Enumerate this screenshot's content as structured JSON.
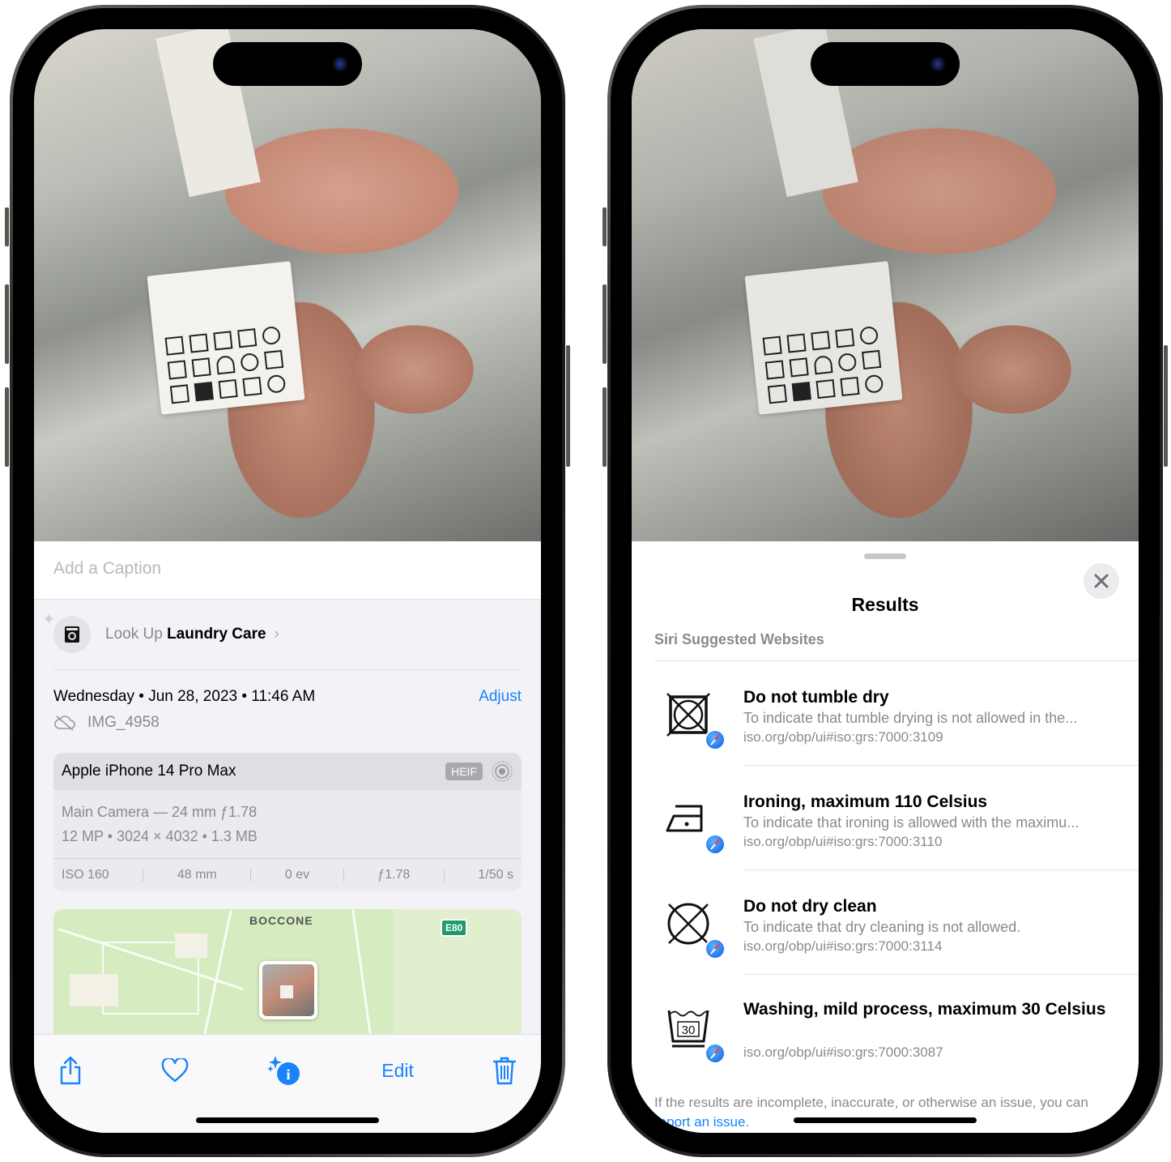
{
  "left_phone": {
    "caption_placeholder": "Add a Caption",
    "lookup": {
      "prefix": "Look Up",
      "subject": "Laundry Care",
      "chevron": "›",
      "icon": "washing-machine-icon"
    },
    "date_line": "Wednesday • Jun 28, 2023 • 11:46 AM",
    "adjust_label": "Adjust",
    "filename": "IMG_4958",
    "camera": {
      "device": "Apple iPhone 14 Pro Max",
      "format_badge": "HEIF",
      "lens": "Main Camera — 24 mm ƒ1.78",
      "specs": "12 MP  •  3024 × 4032  •  1.3 MB",
      "stats": [
        "ISO 160",
        "48 mm",
        "0 ev",
        "ƒ1.78",
        "1/50 s"
      ]
    },
    "map": {
      "place_label": "BOCCONE",
      "road_shield": "E80"
    },
    "toolbar": {
      "edit_label": "Edit",
      "icons": [
        "share-icon",
        "heart-icon",
        "info-sparkle-icon",
        "trash-icon"
      ]
    }
  },
  "right_phone": {
    "sheet_title": "Results",
    "section_header": "Siri Suggested Websites",
    "results": [
      {
        "title": "Do not tumble dry",
        "description": "To indicate that tumble drying is not allowed in the...",
        "url": "iso.org/obp/ui#iso:grs:7000:3109",
        "symbol": "do-not-tumble-dry-icon"
      },
      {
        "title": "Ironing, maximum 110 Celsius",
        "description": "To indicate that ironing is allowed with the maximu...",
        "url": "iso.org/obp/ui#iso:grs:7000:3110",
        "symbol": "iron-low-icon"
      },
      {
        "title": "Do not dry clean",
        "description": "To indicate that dry cleaning is not allowed.",
        "url": "iso.org/obp/ui#iso:grs:7000:3114",
        "symbol": "do-not-dry-clean-icon"
      },
      {
        "title": "Washing, mild process, maximum 30 Celsius",
        "description": "",
        "url": "iso.org/obp/ui#iso:grs:7000:3087",
        "symbol": "wash-30-mild-icon",
        "symbol_text": "30"
      }
    ],
    "footer_text": "If the results are incomplete, inaccurate, or otherwise an issue, you can ",
    "footer_link": "report an issue",
    "footer_end": "."
  },
  "colors": {
    "accent": "#1a82fb",
    "secondary_text": "#8a8a8e",
    "grouped_bg": "#f2f2f7"
  }
}
